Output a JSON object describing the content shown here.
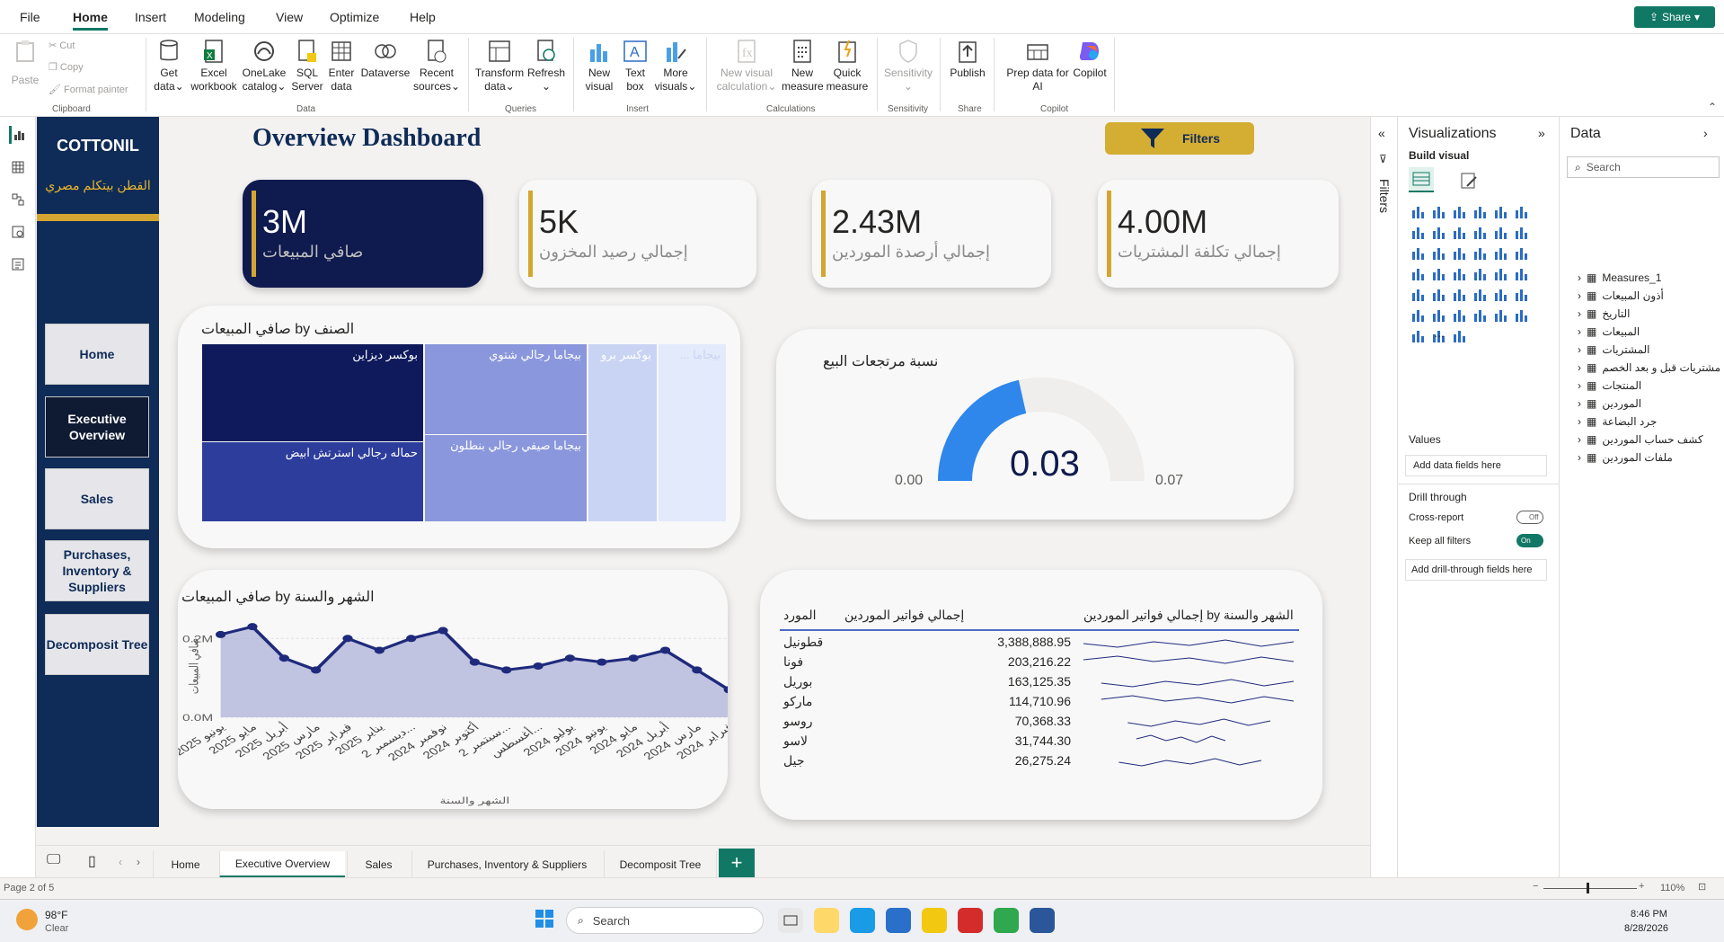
{
  "menu": {
    "items": [
      "File",
      "Home",
      "Insert",
      "Modeling",
      "View",
      "Optimize",
      "Help"
    ],
    "active": "Home",
    "share_label": "Share"
  },
  "ribbon": {
    "clipboard": {
      "paste": "Paste",
      "cut": "Cut",
      "copy": "Copy",
      "format_painter": "Format painter",
      "group": "Clipboard"
    },
    "data": {
      "get_data": "Get",
      "get_data2": "data",
      "excel": "Excel",
      "excel2": "workbook",
      "onelake": "OneLake",
      "onelake2": "catalog",
      "sql": "SQL",
      "sql2": "Server",
      "enter": "Enter",
      "enter2": "data",
      "dataverse": "Dataverse",
      "recent": "Recent",
      "recent2": "sources",
      "group": "Data"
    },
    "queries": {
      "transform": "Transform",
      "transform2": "data",
      "refresh": "Refresh",
      "group": "Queries"
    },
    "insert": {
      "new_visual": "New",
      "new_visual2": "visual",
      "textbox": "Text",
      "textbox2": "box",
      "more": "More",
      "more2": "visuals",
      "group": "Insert"
    },
    "calc": {
      "new_calc": "New visual",
      "new_calc2": "calculation",
      "new_measure": "New",
      "new_measure2": "measure",
      "quick": "Quick",
      "quick2": "measure",
      "group": "Calculations"
    },
    "sensitivity": {
      "label": "Sensitivity",
      "group": "Sensitivity"
    },
    "share": {
      "publish": "Publish",
      "group": "Share"
    },
    "copilot": {
      "prep": "Prep data for",
      "prep2": "AI",
      "copilot": "Copilot",
      "group": "Copilot"
    }
  },
  "report": {
    "logo_title": "COTTONIL",
    "logo_subtitle": "القطن بيتكلم مصري",
    "nav": [
      "Home",
      "Executive Overview",
      "Sales",
      "Purchases, Inventory & Suppliers",
      "Decomposit Tree"
    ],
    "nav_active": "Executive Overview",
    "title": "Overview Dashboard",
    "filters_label": "Filters",
    "kpis": [
      {
        "value": "3M",
        "label": "صافي المبيعات"
      },
      {
        "value": "5K",
        "label": "إجمالي رصيد المخزون"
      },
      {
        "value": "2.43M",
        "label": "إجمالي أرصدة الموردين"
      },
      {
        "value": "4.00M",
        "label": "إجمالي تكلفة المشتريات"
      }
    ],
    "treemap": {
      "title": "صافي المبيعات by الصنف",
      "cells": [
        "بوكسر ديزاين",
        "حماله رجالي استرتش ابيض",
        "بيجاما رجالي شتوي",
        "بيجاما صيفي رجالي بنطلون",
        "بوكسر برو",
        "بيجاما ..."
      ]
    },
    "gauge": {
      "title": "نسبة مرتجعات البيع",
      "value": "0.03",
      "min": "0.00",
      "max": "0.07",
      "fraction": 0.43
    },
    "table": {
      "headers": [
        "المورد",
        "إجمالي فواتير الموردين",
        "إجمالي فواتير الموردين by الشهر والسنة"
      ],
      "rows": [
        {
          "name": "قطونيل",
          "value": "3,388,888.95"
        },
        {
          "name": "فونا",
          "value": "203,216.22"
        },
        {
          "name": "بوريل",
          "value": "163,125.35"
        },
        {
          "name": "ماركو",
          "value": "114,710.96"
        },
        {
          "name": "روسو",
          "value": "70,368.33"
        },
        {
          "name": "لاسو",
          "value": "31,744.30"
        },
        {
          "name": "جيل",
          "value": "26,275.24"
        }
      ]
    }
  },
  "chart_data": {
    "type": "area",
    "title": "صافي المبيعات by الشهر والسنة",
    "xlabel": "الشهر والسنة",
    "ylabel": "صافي المبيعات",
    "x": [
      "يونيو 2025",
      "مايو 2025",
      "أبريل 2025",
      "مارس 2025",
      "فبراير 2025",
      "يناير 2025",
      "ديسمبر 2...",
      "نوفمبر 2024",
      "أكتوبر 2024",
      "سبتمبر 2...",
      "أغسطس...",
      "يوليو 2024",
      "يونيو 2024",
      "مايو 2024",
      "أبريل 2024",
      "مارس 2024",
      "فبراير 2024"
    ],
    "values": [
      0.21,
      0.23,
      0.15,
      0.12,
      0.2,
      0.17,
      0.2,
      0.22,
      0.14,
      0.12,
      0.13,
      0.15,
      0.14,
      0.15,
      0.17,
      0.12,
      0.07
    ],
    "yticks": [
      "0.2M",
      "0.0M"
    ],
    "ylim": [
      0,
      0.26
    ],
    "color": "#1f2a7c"
  },
  "panes": {
    "filters_label": "Filters",
    "viz_title": "Visualizations",
    "build_visual": "Build visual",
    "values_label": "Values",
    "add_data_fields": "Add data fields here",
    "drill_through": "Drill through",
    "cross_report": "Cross-report",
    "cross_report_state": "Off",
    "keep_filters": "Keep all filters",
    "keep_filters_state": "On",
    "add_drill": "Add drill-through fields here",
    "data_title": "Data",
    "search_placeholder": "Search",
    "fields": [
      "Measures_1",
      "أذون المبيعات",
      "التاريخ",
      "المبيعات",
      "المشتريات",
      "مشتريات قبل و بعد الخصم",
      "المنتجات",
      "الموردين",
      "جرد البضاعة",
      "كشف حساب الموردين",
      "ملفات الموردين"
    ]
  },
  "pages": [
    "Home",
    "Executive Overview",
    "Sales",
    "Purchases, Inventory & Suppliers",
    "Decomposit Tree"
  ],
  "pages_active": "Executive Overview",
  "status": {
    "page": "Page 2 of 5",
    "zoom": "110%"
  },
  "taskbar": {
    "temp": "98°F",
    "weather": "Clear",
    "search": "Search",
    "time": "8:46 PM",
    "date": "8/28/2026"
  }
}
